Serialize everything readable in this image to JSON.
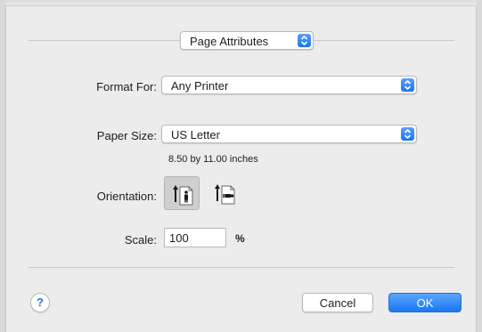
{
  "settings_popup": {
    "value": "Page Attributes"
  },
  "format_for": {
    "label": "Format For:",
    "value": "Any Printer"
  },
  "paper_size": {
    "label": "Paper Size:",
    "value": "US Letter",
    "dimensions": "8.50 by 11.00 inches"
  },
  "orientation": {
    "label": "Orientation:",
    "options": [
      {
        "icon": "portrait-orientation-icon",
        "selected": true
      },
      {
        "icon": "landscape-orientation-icon",
        "selected": false
      }
    ]
  },
  "scale": {
    "label": "Scale:",
    "value": "100",
    "unit": "%"
  },
  "footer": {
    "help_label": "?",
    "cancel_label": "Cancel",
    "ok_label": "OK"
  },
  "colors": {
    "accent": "#1a78f2",
    "background": "#ececec"
  }
}
